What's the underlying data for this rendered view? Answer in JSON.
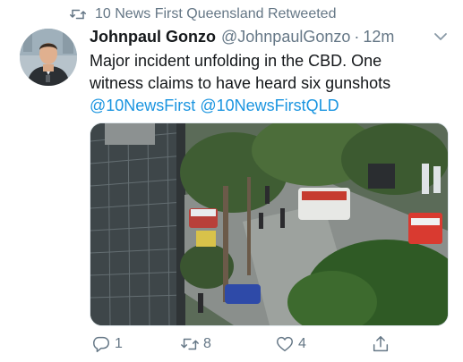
{
  "retweet_context": {
    "icon": "retweet-icon",
    "text": "10 News First Queensland Retweeted"
  },
  "author": {
    "display_name": "Johnpaul Gonzo",
    "handle": "@JohnpaulGonzo",
    "separator": "·",
    "time": "12m"
  },
  "tweet": {
    "line1": "Major incident unfolding in the CBD. One",
    "line2": "witness claims to have heard six gunshots",
    "mention1": "@10NewsFirst",
    "mention2": "@10NewsFirstQLD"
  },
  "actions": {
    "reply_count": "1",
    "retweet_count": "8",
    "like_count": "4"
  },
  "colors": {
    "text_primary": "#14171a",
    "text_secondary": "#657786",
    "link": "#1b95e0"
  }
}
